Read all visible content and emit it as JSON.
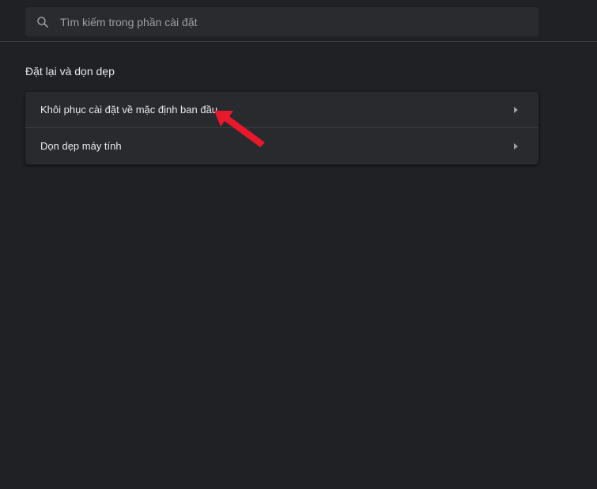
{
  "search": {
    "placeholder": "Tìm kiếm trong phần cài đặt",
    "value": ""
  },
  "section": {
    "title": "Đặt lại và dọn dẹp",
    "items": [
      {
        "label": "Khôi phục cài đặt về mặc định ban đầu",
        "icon": "chevron-right-icon"
      },
      {
        "label": "Dọn dẹp máy tính",
        "icon": "chevron-right-icon"
      }
    ]
  },
  "colors": {
    "background": "#202124",
    "card": "#292a2d",
    "text": "#e8eaed",
    "annotation_arrow": "#e8192c"
  }
}
